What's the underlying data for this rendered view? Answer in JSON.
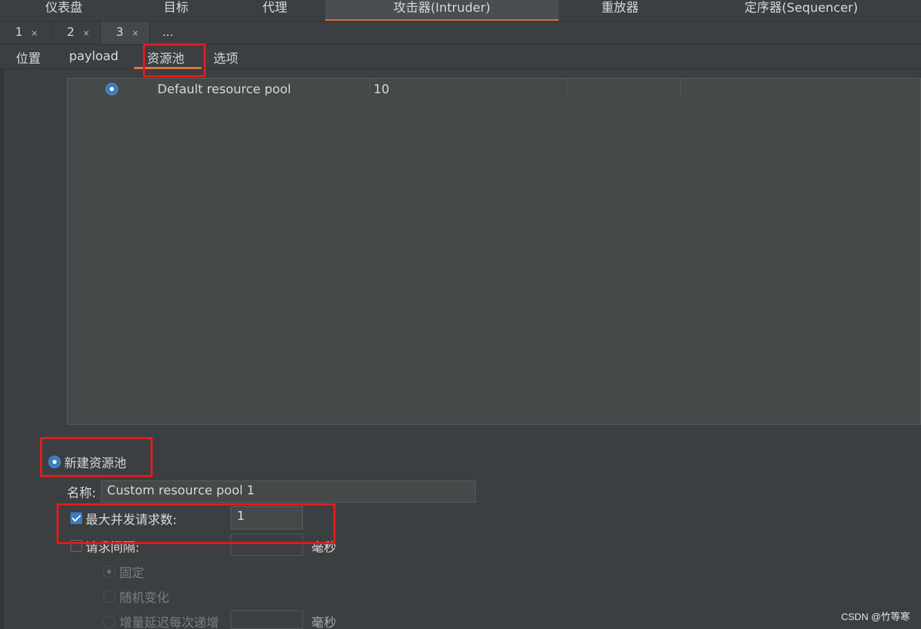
{
  "main_tabs": [
    {
      "label": "仪表盘",
      "active": false
    },
    {
      "label": "目标",
      "active": false
    },
    {
      "label": "代理",
      "active": false
    },
    {
      "label": "攻击器(Intruder)",
      "active": true
    },
    {
      "label": "重放器",
      "active": false
    },
    {
      "label": "定序器(Sequencer)",
      "active": false
    }
  ],
  "num_tabs": [
    {
      "label": "1",
      "close": "×"
    },
    {
      "label": "2",
      "close": "×"
    },
    {
      "label": "3",
      "close": "×"
    },
    {
      "label": "...",
      "close": ""
    }
  ],
  "sub_tabs": [
    {
      "label": "位置"
    },
    {
      "label": "payload"
    },
    {
      "label": "资源池",
      "active": true
    },
    {
      "label": "选项"
    }
  ],
  "pool_table": {
    "rows": [
      {
        "selected": true,
        "name": "Default resource pool",
        "max_concurrent": "10"
      }
    ]
  },
  "new_pool": {
    "radio_label": "新建资源池",
    "name_label": "名称:",
    "name_value": "Custom resource pool 1",
    "max_concurrent_label": "最大并发请求数:",
    "max_concurrent_checked": true,
    "max_concurrent_value": "1",
    "delay_label": "请求间隔:",
    "delay_checked": false,
    "delay_value": "",
    "delay_unit": "毫秒",
    "fixed_label": "固定",
    "random_label": "随机变化",
    "increment_label": "增量延迟每次递增",
    "increment_value": "",
    "increment_unit": "毫秒"
  },
  "watermark": "CSDN @竹等寒",
  "colors": {
    "background": "#3c3f41",
    "accent_orange": "#e27a3f",
    "highlight_red": "#e41b1b",
    "selection_blue": "#3a7bc2"
  }
}
